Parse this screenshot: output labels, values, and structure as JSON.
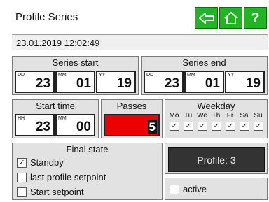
{
  "header": {
    "title": "Profile Series"
  },
  "datetime": "23.01.2019 12:02:49",
  "icons": {
    "back": "back-arrow-icon",
    "home": "home-icon",
    "help": "question-mark-icon"
  },
  "colors": {
    "accent_green": "#22b422",
    "passes_red": "#ee0000",
    "profile_dark": "#333333"
  },
  "series_start": {
    "label": "Series start",
    "day_tag": "DD",
    "day": "23",
    "month_tag": "MM",
    "month": "01",
    "year_tag": "YY",
    "year": "19"
  },
  "series_end": {
    "label": "Series end",
    "day_tag": "DD",
    "day": "23",
    "month_tag": "MM",
    "month": "01",
    "year_tag": "YY",
    "year": "19"
  },
  "start_time": {
    "label": "Start time",
    "hour_tag": "HH",
    "hour": "23",
    "minute_tag": "MM",
    "minute": "00"
  },
  "passes": {
    "label": "Passes",
    "value": "5"
  },
  "weekday": {
    "label": "Weekday",
    "days": [
      "Mo",
      "Tu",
      "We",
      "Th",
      "Fr",
      "Sa",
      "Su"
    ],
    "checked": [
      true,
      true,
      true,
      true,
      true,
      true,
      true
    ],
    "check_mark": "✓"
  },
  "final_state": {
    "label": "Final state",
    "options": [
      {
        "label": "Standby",
        "checked": true
      },
      {
        "label": "last profile setpoint",
        "checked": false
      },
      {
        "label": "Start setpoint",
        "checked": false
      }
    ]
  },
  "profile_button": {
    "label": "Profile: 3"
  },
  "active": {
    "label": "active",
    "checked": false
  }
}
